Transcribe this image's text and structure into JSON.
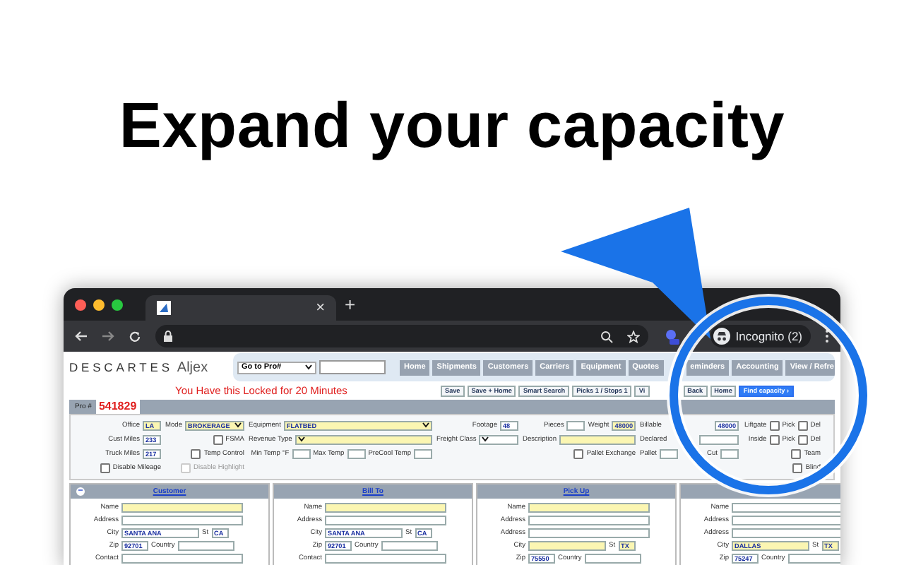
{
  "headline": "Expand your capacity",
  "browser": {
    "tab_close": "×",
    "new_tab": "+",
    "profile": "Incognito (2)"
  },
  "page": {
    "logo": {
      "brand": "DESCARTES",
      "product": "Aljex"
    },
    "goto": {
      "value": "Go to Pro#"
    },
    "nav": [
      "Home",
      "Shipments",
      "Customers",
      "Carriers",
      "Equipment",
      "Quotes",
      "eminders",
      "Accounting",
      "View / Refre"
    ],
    "lock_message": "You Have this Locked for 20 Minutes",
    "actions": [
      {
        "label": "Save",
        "primary": false
      },
      {
        "label": "Save + Home",
        "primary": false
      },
      {
        "label": "Smart Search",
        "primary": false
      },
      {
        "label": "Picks 1 / Stops 1",
        "primary": false
      },
      {
        "label": "Vi",
        "primary": false
      },
      {
        "label": "Back",
        "primary": false
      },
      {
        "label": "Home",
        "primary": false
      },
      {
        "label": "Find capacity ›",
        "primary": true
      }
    ],
    "pro": {
      "label": "Pro #",
      "number": "541829"
    },
    "form_columns": [
      [
        [
          {
            "kind": "label",
            "text": "Office"
          },
          {
            "kind": "box",
            "value": "LA",
            "highlight": true
          }
        ],
        [
          {
            "kind": "label",
            "text": "Cust Miles"
          },
          {
            "kind": "box",
            "value": "233",
            "highlight": false
          }
        ],
        [
          {
            "kind": "label",
            "text": "Truck Miles"
          },
          {
            "kind": "box",
            "value": "217",
            "highlight": false
          }
        ],
        [
          {
            "kind": "check",
            "text": "Disable Mileage",
            "checked": false,
            "disabled": false
          }
        ]
      ],
      [
        [
          {
            "kind": "label",
            "text": "Mode"
          },
          {
            "kind": "select",
            "value": "BROKERAGE",
            "highlight": true
          }
        ],
        [
          {
            "kind": "check",
            "text": "FSMA",
            "checked": false,
            "disabled": false
          }
        ],
        [
          {
            "kind": "check",
            "text": "Temp Control",
            "checked": false,
            "disabled": false
          }
        ],
        [
          {
            "kind": "check",
            "text": "Disable Highlight",
            "checked": false,
            "disabled": true
          }
        ]
      ],
      [
        [
          {
            "kind": "label",
            "text": "Equipment"
          },
          {
            "kind": "select",
            "value": "FLATBED",
            "highlight": true
          }
        ],
        [
          {
            "kind": "label",
            "text": "Revenue Type"
          },
          {
            "kind": "select",
            "highlight": true
          }
        ],
        [
          {
            "kind": "label",
            "text": "Min Temp °F"
          },
          {
            "kind": "box",
            "highlight": false
          },
          {
            "kind": "label",
            "text": "Max Temp"
          },
          {
            "kind": "box",
            "highlight": false
          },
          {
            "kind": "label",
            "text": "PreCool Temp"
          },
          {
            "kind": "box",
            "highlight": false
          }
        ]
      ],
      [
        [
          {
            "kind": "label",
            "text": "Footage"
          },
          {
            "kind": "box",
            "value": "48",
            "highlight": false
          }
        ],
        [
          {
            "kind": "label",
            "text": "Freight Class"
          },
          {
            "kind": "select",
            "highlight": false
          }
        ]
      ],
      [
        [
          {
            "kind": "label",
            "text": "Pieces"
          },
          {
            "kind": "box",
            "highlight": false
          },
          {
            "kind": "label",
            "text": "Weight"
          },
          {
            "kind": "box",
            "value": "48000",
            "highlight": true
          }
        ],
        [
          {
            "kind": "label",
            "text": "Description"
          },
          {
            "kind": "wide",
            "highlight": true
          }
        ],
        [
          {
            "kind": "check",
            "text": "Pallet Exchange",
            "checked": false,
            "disabled": false
          }
        ]
      ],
      [
        [
          {
            "kind": "label",
            "text": "Billable"
          },
          {
            "kind": "box",
            "value": "48000",
            "highlight": false
          }
        ],
        [
          {
            "kind": "label",
            "text": "Declared"
          },
          {
            "kind": "medium",
            "highlight": false
          }
        ],
        [
          {
            "kind": "label",
            "text": "Pallet"
          },
          {
            "kind": "box",
            "highlight": false
          },
          {
            "kind": "label",
            "text": "Cut"
          },
          {
            "kind": "box",
            "highlight": false
          }
        ]
      ],
      [
        [
          {
            "kind": "label",
            "text": "Liftgate"
          },
          {
            "kind": "check",
            "text": "Pick",
            "checked": false,
            "disabled": false
          },
          {
            "kind": "check",
            "text": "Del",
            "checked": false,
            "disabled": false
          }
        ],
        [
          {
            "kind": "label",
            "text": "Inside"
          },
          {
            "kind": "check",
            "text": "Pick",
            "checked": false,
            "disabled": false
          },
          {
            "kind": "check",
            "text": "Del",
            "checked": false,
            "disabled": false
          }
        ],
        [
          {
            "kind": "check",
            "text": "Team",
            "checked": false,
            "disabled": false
          }
        ],
        [
          {
            "kind": "check",
            "text": "Blind",
            "checked": false,
            "disabled": false
          }
        ]
      ]
    ],
    "sections": [
      {
        "title": "Customer",
        "collapse": "−",
        "rows": [
          {
            "kind": "single",
            "label": "Name",
            "highlight": true
          },
          {
            "kind": "single",
            "label": "Address",
            "highlight": false
          },
          {
            "kind": "long-short",
            "label": "City",
            "value": "SANTA ANA",
            "highlight": false,
            "label_2": "St",
            "value_2": "CA",
            "highlight_2": false
          },
          {
            "kind": "short-long",
            "label": "Zip",
            "value": "92701",
            "highlight": false,
            "label_2": "Country",
            "highlight_2": false
          },
          {
            "kind": "single",
            "label": "Contact",
            "highlight": false
          }
        ]
      },
      {
        "title": "Bill To",
        "rows": [
          {
            "kind": "single",
            "label": "Name",
            "highlight": true
          },
          {
            "kind": "single",
            "label": "Address",
            "highlight": false
          },
          {
            "kind": "long-short",
            "label": "City",
            "value": "SANTA ANA",
            "highlight": false,
            "label_2": "St",
            "value_2": "CA",
            "highlight_2": false
          },
          {
            "kind": "short-long",
            "label": "Zip",
            "value": "92701",
            "highlight": false,
            "label_2": "Country",
            "highlight_2": false
          },
          {
            "kind": "single",
            "label": "Contact",
            "highlight": false
          }
        ]
      },
      {
        "title": "Pick Up",
        "rows": [
          {
            "kind": "single",
            "label": "Name",
            "highlight": true
          },
          {
            "kind": "single",
            "label": "Address",
            "highlight": false
          },
          {
            "kind": "single",
            "label": "Address",
            "highlight": false
          },
          {
            "kind": "long-short",
            "label": "City",
            "highlight": true,
            "label_2": "St",
            "value_2": "TX",
            "highlight_2": true
          },
          {
            "kind": "short-long",
            "label": "Zip",
            "value": "75550",
            "highlight": false,
            "label_2": "Country",
            "highlight_2": false
          }
        ]
      },
      {
        "rows": [
          {
            "kind": "single",
            "label": "Name",
            "highlight": false
          },
          {
            "kind": "single",
            "label": "Address",
            "highlight": false
          },
          {
            "kind": "single",
            "label": "Address",
            "highlight": false
          },
          {
            "kind": "long-short",
            "label": "City",
            "value": "DALLAS",
            "highlight": true,
            "label_2": "St",
            "value_2": "TX",
            "highlight_2": true
          },
          {
            "kind": "short-long",
            "label": "Zip",
            "value": "75247",
            "highlight": false,
            "label_2": "Country",
            "highlight_2": false
          }
        ]
      }
    ]
  }
}
